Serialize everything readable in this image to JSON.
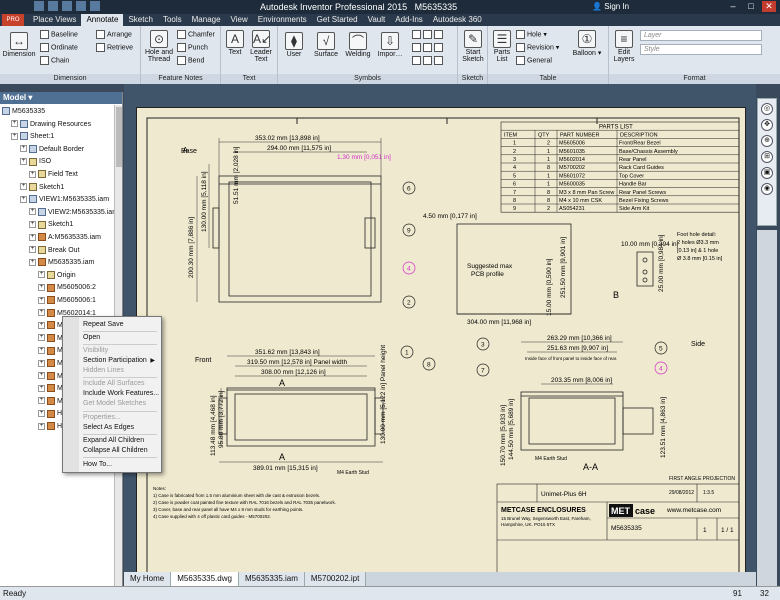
{
  "app": {
    "window_title": "Autodesk Inventor Professional 2015",
    "document": "M5635335",
    "sign_in": "Sign In",
    "pro_badge": "PRO"
  },
  "ribbon_tabs": [
    "Place Views",
    "Annotate",
    "Sketch",
    "Tools",
    "Manage",
    "View",
    "Environments",
    "Get Started",
    "Vault",
    "Add-Ins",
    "Autodesk 360"
  ],
  "ribbon": {
    "dimension": {
      "big": "Dimension",
      "baseline": "Baseline",
      "ordinate": "Ordinate",
      "chain": "Chain",
      "arrange": "Arrange",
      "retrieve": "Retrieve",
      "label": "Dimension"
    },
    "feature_notes": {
      "hole_thread": "Hole and Thread",
      "chamfer": "Chamfer",
      "punch": "Punch",
      "bend": "Bend",
      "label": "Feature Notes"
    },
    "text": {
      "text": "Text",
      "leader_text": "Leader Text",
      "label": "Text"
    },
    "symbols": {
      "user": "User",
      "surface": "Surface",
      "welding": "Welding",
      "import": "Impor…",
      "label": "Symbols"
    },
    "sketch": {
      "start_sketch": "Start Sketch",
      "label": "Sketch"
    },
    "table": {
      "parts_list": "Parts List",
      "hole": "Hole",
      "revision": "Revision",
      "general": "General",
      "label": "Table"
    },
    "balloon": {
      "balloon": "Balloon",
      "label": ""
    },
    "format": {
      "edit_layers": "Edit Layers",
      "layer": "Layer",
      "style": "Style",
      "label": "Format"
    }
  },
  "browser": {
    "title": "Model",
    "nodes": [
      {
        "label": "M5635335",
        "indent": 0
      },
      {
        "label": "Drawing Resources",
        "indent": 1
      },
      {
        "label": "Sheet:1",
        "indent": 1
      },
      {
        "label": "Default Border",
        "indent": 2
      },
      {
        "label": "ISO",
        "indent": 2
      },
      {
        "label": "Field Text",
        "indent": 3
      },
      {
        "label": "Sketch1",
        "indent": 2
      },
      {
        "label": "VIEW1:M5635335.iam",
        "indent": 2
      },
      {
        "label": "VIEW2:M5635335.iam",
        "indent": 3
      },
      {
        "label": "Sketch1",
        "indent": 3
      },
      {
        "label": "A:M5635335.iam",
        "indent": 3
      },
      {
        "label": "Break Out",
        "indent": 3
      },
      {
        "label": "M5635335.iam",
        "indent": 3
      },
      {
        "label": "Origin",
        "indent": 4
      },
      {
        "label": "M5605006:2",
        "indent": 4
      },
      {
        "label": "M5605006:1",
        "indent": 4
      },
      {
        "label": "M5602014:1",
        "indent": 4
      },
      {
        "label": "M5700202:1",
        "indent": 4
      },
      {
        "label": "M4 x 10 mm CSK",
        "indent": 4
      },
      {
        "label": "M4 x 10 mm CSK",
        "indent": 4
      },
      {
        "label": "M4 x 10 mm CSK",
        "indent": 4
      },
      {
        "label": "M4 x 10 mm CSK",
        "indent": 4
      },
      {
        "label": "M4 x 10 mm CSK",
        "indent": 4
      },
      {
        "label": "M4 x 10 mm CSK",
        "indent": 4
      },
      {
        "label": "Handle:1",
        "indent": 4
      },
      {
        "label": "Handle:2",
        "indent": 4
      }
    ]
  },
  "context_menu": {
    "repeat_save": "Repeat Save",
    "open": "Open",
    "visibility": "Visibility",
    "section_participation": "Section Participation",
    "hidden_lines": "Hidden Lines",
    "include_all_surfaces": "Include All Surfaces",
    "include_work_features": "Include Work Features...",
    "get_model_sketches": "Get Model Sketches",
    "properties": "Properties...",
    "select_as_edges": "Select As Edges",
    "expand_all": "Expand All Children",
    "collapse_all": "Collapse All Children",
    "how_to": "How To..."
  },
  "drawing": {
    "base_label": "Base",
    "front_label": "Front",
    "side_label": "Side",
    "dims": {
      "d353": "353.02 mm [13,898 in]",
      "d294": "294.00 mm [11,575 in]",
      "d130": "130.00 mm [5,118 in]",
      "d200": "200.30 mm [7,886 in]",
      "d5151": "51.51 mm [2,028 in]",
      "d130mag": "1.30 mm [0,051 in]",
      "d450": "4.50 mm [0,177 in]",
      "d304": "304.00 mm [11,968 in]",
      "d1500": "15.00 mm [0,590 in]",
      "d25150": "251.50 mm [9,901 in]",
      "d351": "351.62 mm [13,843 in]",
      "d319": "319.50 mm [12,578 in] Panel width",
      "d308": "308.00 mm [12,126 in]",
      "d389": "389.01 mm [15,315 in]",
      "d11348": "113.48 mm [4,468 in]",
      "d9580": "95.80 mm [3,772 in]",
      "d13000b": "130.00 mm [5,122 in] Panel height",
      "d263": "263.29 mm [10,366 in]",
      "d251": "251.63 mm [9,907 in]",
      "d203": "203.35 mm [8,006 in]",
      "d150": "150.70 mm [5,933 in]",
      "d144": "144.50 mm [5,689 in]",
      "d123": "123.51 mm [4,863 in]",
      "d1000": "10.00 mm [0,394 in]",
      "d2500": "25.00 mm [0,984 in]",
      "pcb": "Suggested max PCB profile",
      "pcb1": "Suggested max",
      "pcb2": "PCB profile",
      "inside_face": "Inside face of front panel to inside face of rear.",
      "m4_stud": "M4 Earth Stud",
      "m4_stud2": "M4 Earth Stud",
      "aa": "A-A",
      "a_left": "A",
      "a_right": "A",
      "b": "B",
      "foot_hole": "Foot hole detail: 2 holes Ø3.3 mm (0.13 in) & 1 hole Ø 3.8 mm (0.15 in)",
      "foot1": "Foot hole detail:",
      "foot2": "2 holes Ø3.3 mm",
      "foot3": "[0.13 in] & 1 hole",
      "foot4": "Ø 3.8 mm [0.15 in]",
      "first_angle": "FIRST ANGLE PROJECTION"
    },
    "balloons": [
      "6",
      "9",
      "4",
      "2",
      "1",
      "8",
      "3",
      "7",
      "5",
      "4"
    ],
    "parts_list": {
      "title": "PARTS LIST",
      "headers": [
        "ITEM",
        "QTY",
        "PART NUMBER",
        "DESCRIPTION"
      ],
      "rows": [
        [
          "1",
          "2",
          "M5605006",
          "Front/Rear Bezel"
        ],
        [
          "2",
          "1",
          "M5601035",
          "Base/Chassis Assembly"
        ],
        [
          "3",
          "1",
          "M5602014",
          "Rear Panel"
        ],
        [
          "4",
          "8",
          "M5700202",
          "Rack Card Guides"
        ],
        [
          "5",
          "1",
          "M5601072",
          "Top Cover"
        ],
        [
          "6",
          "1",
          "M5600035",
          "Handle Bar"
        ],
        [
          "7",
          "8",
          "M3 x 8 mm Pan Screw",
          "Rear Panel Screws"
        ],
        [
          "8",
          "8",
          "M4 x 10 mm CSK",
          "Bezel Fixing Screws"
        ],
        [
          "9",
          "2",
          "AS054231",
          "Side Arm Kit"
        ]
      ]
    },
    "notes": [
      "Notes:",
      "1) Case is fabricated from 1.5 mm aluminium sheet with die cast & extrusion bezels.",
      "2) Case is powder coat painted fine texture with RAL 7016 bezels and RAL 7035 panelwork.",
      "3) Cover, base and rear panel all have M4 x 8 mm studs for earthing points.",
      "4) Case supplied with 4 off plastic card guides - M5700202."
    ],
    "title_block": {
      "company": "METCASE ENCLOSURES",
      "address1": "15 Brunel Way, Segensworth East, Fareham,",
      "address2": "Hampshire, UK. PO15 5TX",
      "product": "Unimet-Plus 6H",
      "drawing_no": "M5635335",
      "logo_met": "MET",
      "logo_case": "case",
      "web": "www.metcase.com",
      "date": "29/08/2012",
      "scale": "1:3.5",
      "issue": "1",
      "sheet": "1 / 1"
    }
  },
  "doc_tabs": [
    "My Home",
    "M5635335.dwg",
    "M5635335.iam",
    "M5700202.ipt"
  ],
  "status": {
    "text": "Ready",
    "num1": "91",
    "num2": "32"
  }
}
